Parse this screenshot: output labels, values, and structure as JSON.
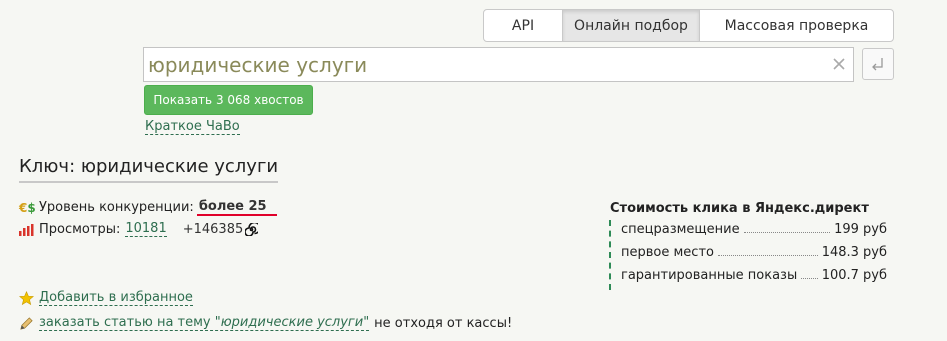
{
  "tabs": [
    {
      "label": "API",
      "active": false
    },
    {
      "label": "Онлайн подбор",
      "active": true
    },
    {
      "label": "Массовая проверка",
      "active": false
    }
  ],
  "search": {
    "value": "юридические услуги",
    "clear_icon": "close-icon",
    "enter_icon": "enter-arrow-icon"
  },
  "show_button": {
    "label": "Показать 3 068 хвостов"
  },
  "faq_link": "Краткое ЧаВо",
  "key_title": "Ключ: юридические услуги",
  "competition": {
    "icon": "euro-dollar-icon",
    "label": "Уровень конкуренции:",
    "value": "более 25"
  },
  "views": {
    "icon": "bar-chart-icon",
    "label": "Просмотры:",
    "value": "10181",
    "extra": "+146385",
    "extra_icon": "spiral-icon"
  },
  "favorite": {
    "icon": "star-icon",
    "label": "Добавить в избранное"
  },
  "order": {
    "icon": "pencil-icon",
    "prefix": "заказать статью на тему ",
    "topic": "\"юридические услуги\"",
    "suffix": "не отходя от кассы!"
  },
  "cost": {
    "title": "Стоимость клика в Яндекс.директ",
    "items": [
      {
        "label": "спецразмещение",
        "price": "199 руб"
      },
      {
        "label": "первое место",
        "price": "148.3 руб"
      },
      {
        "label": "гарантированные показы",
        "price": "100.7 руб"
      }
    ]
  },
  "colors": {
    "accent_green": "#5cb85c",
    "link_green": "#2e6e4f",
    "underline_red": "#e0002a"
  }
}
